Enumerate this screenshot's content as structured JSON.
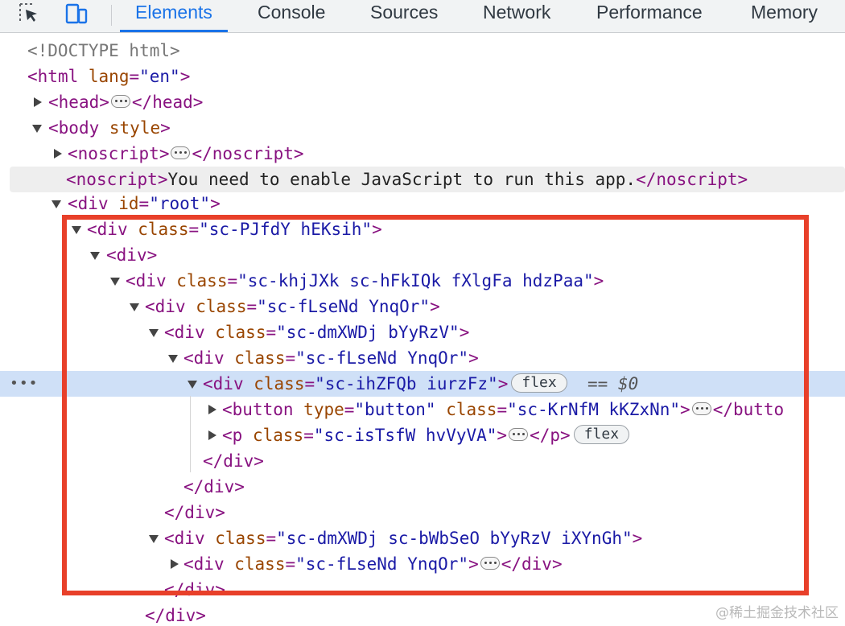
{
  "toolbar": {
    "icons": [
      "inspect-element-icon",
      "device-toolbar-icon"
    ],
    "tabs": [
      {
        "label": "Elements",
        "active": true
      },
      {
        "label": "Console",
        "active": false
      },
      {
        "label": "Sources",
        "active": false
      },
      {
        "label": "Network",
        "active": false
      },
      {
        "label": "Performance",
        "active": false
      },
      {
        "label": "Memory",
        "active": false
      }
    ],
    "accent_color": "#1a73e8"
  },
  "dom": {
    "doctype": "<!DOCTYPE html>",
    "html_tag": "html",
    "html_lang_attr": "lang",
    "html_lang_val": "\"en\"",
    "head_tag": "head",
    "body_tag": "body",
    "body_attr": "style",
    "noscript_tag": "noscript",
    "noscript_text": "You need to enable JavaScript to run this app.",
    "div_tag": "div",
    "id_attr": "id",
    "root_val": "\"root\"",
    "class_attr": "class",
    "type_attr": "type",
    "button_tag": "button",
    "button_type_val": "\"button\"",
    "p_tag": "p",
    "cls1": "\"sc-PJfdY hEKsih\"",
    "cls2": "\"sc-khjJXk sc-hFkIQk fXlgFa hdzPaa\"",
    "cls3": "\"sc-fLseNd YnqOr\"",
    "cls4": "\"sc-dmXWDj bYyRzV\"",
    "cls6": "\"sc-ihZFQb iurzFz\"",
    "cls_button": "\"sc-KrNfM kKZxNn\"",
    "cls_p": "\"sc-isTsfW hvVyVA\"",
    "cls_div2": "\"sc-dmXWDj sc-bWbSeO bYyRzV iXYnGh\"",
    "flex_badge": "flex",
    "selected_marker": "== $0",
    "button_close_partial": "</butto"
  },
  "annotation": {
    "highlight_color": "#e8402a"
  },
  "watermark": "@稀土掘金技术社区"
}
